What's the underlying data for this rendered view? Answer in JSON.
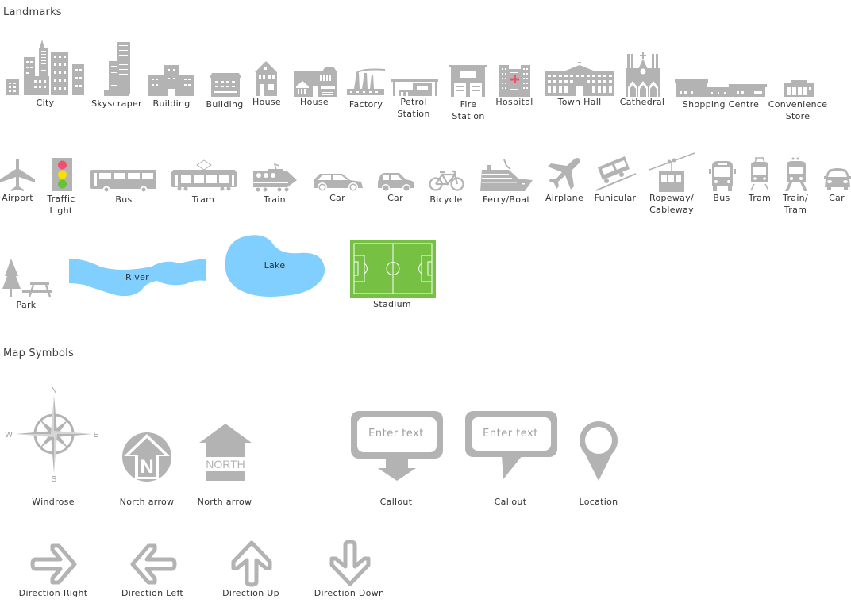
{
  "sections": {
    "landmarks": "Landmarks",
    "map_symbols": "Map Symbols"
  },
  "colors": {
    "icon_gray": "#b3b3b3",
    "water": "#80cfff",
    "pitch_green": "#76c043",
    "traffic_red": "#f0506e",
    "traffic_yellow": "#f5e000",
    "traffic_green": "#66c23a",
    "hospital_cross": "#f0506e"
  },
  "landmarks": {
    "row1": [
      {
        "icon": "city-icon",
        "label": "City"
      },
      {
        "icon": "skyscraper-icon",
        "label": "Skyscraper"
      },
      {
        "icon": "building-icon",
        "label": "Building"
      },
      {
        "icon": "building-icon",
        "label": "Building"
      },
      {
        "icon": "house-icon",
        "label": "House"
      },
      {
        "icon": "house-icon",
        "label": "House"
      },
      {
        "icon": "factory-icon",
        "label": "Factory"
      },
      {
        "icon": "petrol-station-icon",
        "label": "Petrol\nStation"
      },
      {
        "icon": "fire-station-icon",
        "label": "Fire\nStation"
      },
      {
        "icon": "hospital-icon",
        "label": "Hospital"
      },
      {
        "icon": "town-hall-icon",
        "label": "Town Hall"
      },
      {
        "icon": "cathedral-icon",
        "label": "Cathedral"
      },
      {
        "icon": "shopping-centre-icon",
        "label": "Shopping Centre"
      },
      {
        "icon": "convenience-store-icon",
        "label": "Convenience\nStore"
      }
    ],
    "row2": [
      {
        "icon": "airport-icon",
        "label": "Airport"
      },
      {
        "icon": "traffic-light-icon",
        "label": "Traffic\nLight"
      },
      {
        "icon": "bus-icon",
        "label": "Bus"
      },
      {
        "icon": "tram-icon",
        "label": "Tram"
      },
      {
        "icon": "train-icon",
        "label": "Train"
      },
      {
        "icon": "car-icon",
        "label": "Car"
      },
      {
        "icon": "car-icon",
        "label": "Car"
      },
      {
        "icon": "bicycle-icon",
        "label": "Bicycle"
      },
      {
        "icon": "ferry-boat-icon",
        "label": "Ferry/Boat"
      },
      {
        "icon": "airplane-icon",
        "label": "Airplane"
      },
      {
        "icon": "funicular-icon",
        "label": "Funicular"
      },
      {
        "icon": "ropeway-icon",
        "label": "Ropeway/\nCableway"
      },
      {
        "icon": "bus-front-icon",
        "label": "Bus"
      },
      {
        "icon": "tram-front-icon",
        "label": "Tram"
      },
      {
        "icon": "train-tram-front-icon",
        "label": "Train/\nTram"
      },
      {
        "icon": "car-front-icon",
        "label": "Car"
      }
    ],
    "row3": [
      {
        "icon": "park-icon",
        "label": "Park"
      },
      {
        "icon": "river-shape",
        "label": "River"
      },
      {
        "icon": "lake-shape",
        "label": "Lake"
      },
      {
        "icon": "stadium-icon",
        "label": "Stadium"
      }
    ]
  },
  "map_symbols": {
    "row1": [
      {
        "icon": "windrose-icon",
        "label": "Windrose",
        "directions": {
          "n": "N",
          "s": "S",
          "e": "E",
          "w": "W"
        }
      },
      {
        "icon": "north-arrow-circle-icon",
        "label": "North arrow",
        "glyph": "N"
      },
      {
        "icon": "north-arrow-house-icon",
        "label": "North arrow",
        "glyph": "NORTH"
      },
      {
        "icon": "callout-arrow-icon",
        "label": "Callout",
        "placeholder": "Enter text"
      },
      {
        "icon": "callout-speech-icon",
        "label": "Callout",
        "placeholder": "Enter text"
      },
      {
        "icon": "location-pin-icon",
        "label": "Location"
      }
    ],
    "row2": [
      {
        "icon": "direction-right-icon",
        "label": "Direction Right"
      },
      {
        "icon": "direction-left-icon",
        "label": "Direction Left"
      },
      {
        "icon": "direction-up-icon",
        "label": "Direction Up"
      },
      {
        "icon": "direction-down-icon",
        "label": "Direction Down"
      }
    ]
  }
}
